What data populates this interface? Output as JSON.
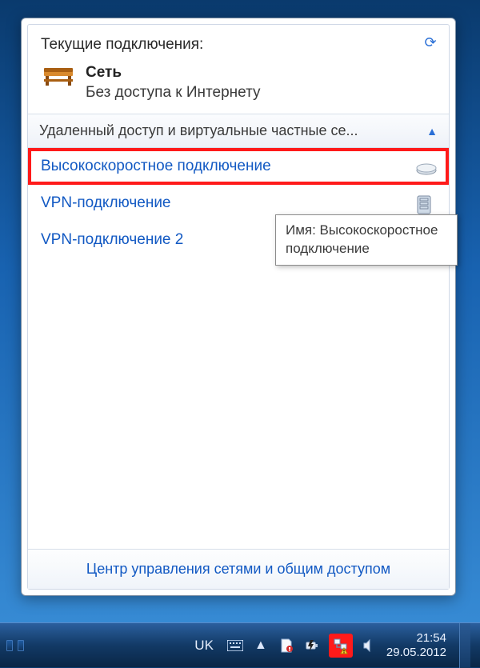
{
  "header": {
    "title": "Текущие подключения:"
  },
  "current": {
    "name": "Сеть",
    "status": "Без доступа к Интернету"
  },
  "section": {
    "label": "Удаленный доступ и виртуальные частные се..."
  },
  "connections": [
    {
      "label": "Высокоскоростное подключение",
      "highlight": true,
      "icon": "modem"
    },
    {
      "label": "VPN-подключение",
      "highlight": false,
      "icon": "server"
    },
    {
      "label": "VPN-подключение 2",
      "highlight": false,
      "icon": "server"
    }
  ],
  "tooltip": {
    "text": "Имя: Высокоскоростное подключение"
  },
  "footer": {
    "link": "Центр управления сетями и общим доступом"
  },
  "taskbar": {
    "lang": "UK",
    "time": "21:54",
    "date": "29.05.2012"
  }
}
